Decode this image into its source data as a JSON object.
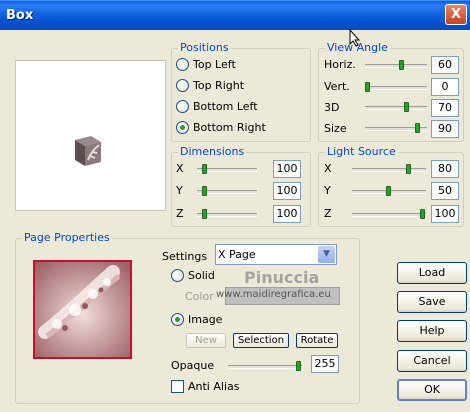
{
  "window": {
    "title": "Box",
    "close_glyph": "X"
  },
  "positions": {
    "label": "Positions",
    "options": [
      "Top Left",
      "Top Right",
      "Bottom Left",
      "Bottom Right"
    ],
    "selected": "Bottom Right"
  },
  "view_angle": {
    "label": "View Angle",
    "rows": [
      {
        "label": "Horiz.",
        "value": "60",
        "level": 60
      },
      {
        "label": "Vert.",
        "value": "0",
        "level": 0
      },
      {
        "label": "3D",
        "value": "70",
        "level": 70
      },
      {
        "label": "Size",
        "value": "90",
        "level": 90
      }
    ]
  },
  "dimensions": {
    "label": "Dimensions",
    "rows": [
      {
        "label": "X",
        "value": "100",
        "level": 10
      },
      {
        "label": "Y",
        "value": "100",
        "level": 10
      },
      {
        "label": "Z",
        "value": "100",
        "level": 10
      }
    ]
  },
  "light_source": {
    "label": "Light Source",
    "rows": [
      {
        "label": "X",
        "value": "80",
        "level": 80
      },
      {
        "label": "Y",
        "value": "50",
        "level": 50
      },
      {
        "label": "Z",
        "value": "100",
        "level": 100
      }
    ]
  },
  "page_properties": {
    "label": "Page Properties",
    "settings_label": "Settings",
    "settings_value": "X Page",
    "solid_label": "Solid",
    "color_label": "Color",
    "image_label": "Image",
    "selected_mode": "Image",
    "new_label": "New",
    "selection_label": "Selection",
    "rotate_label": "Rotate",
    "opaque_label": "Opaque",
    "opaque_value": "255",
    "opaque_level": 100,
    "anti_alias_label": "Anti Alias",
    "anti_alias_checked": false
  },
  "buttons": {
    "load": "Load",
    "save": "Save",
    "help": "Help",
    "cancel": "Cancel",
    "ok": "OK"
  },
  "watermark": {
    "line1": "Pinuccia",
    "line2": "www.maidiregrafica.eu"
  },
  "colors": {
    "accent": "#0046d5",
    "thumb": "#2b9e2b",
    "titlebar": "#0857d8",
    "frame": "#c8102e"
  }
}
